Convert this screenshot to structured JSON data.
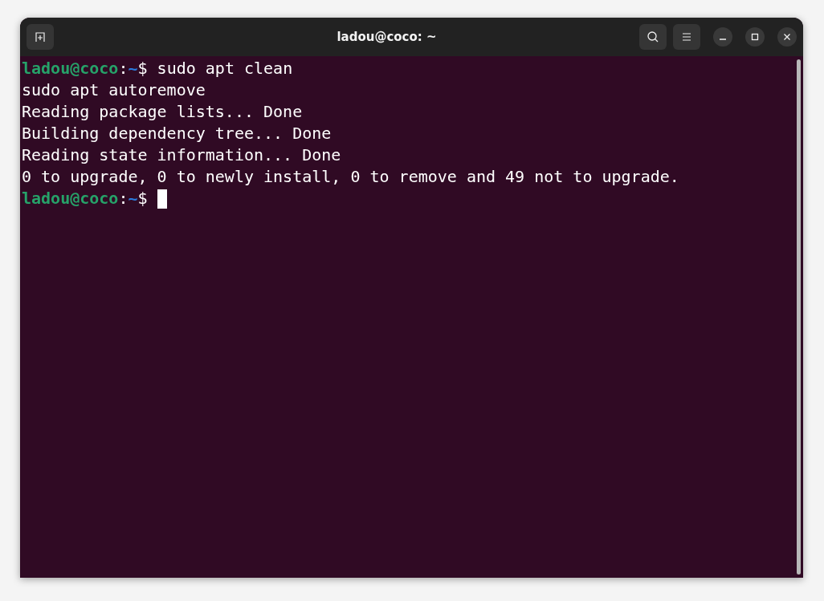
{
  "window": {
    "title": "ladou@coco: ~"
  },
  "terminal": {
    "lines": [
      {
        "kind": "prompt",
        "user_host": "ladou@coco",
        "separator": ":",
        "path": "~",
        "symbol": "$",
        "command": "sudo apt clean",
        "cursor": false
      },
      {
        "kind": "output",
        "text": "sudo apt autoremove"
      },
      {
        "kind": "output",
        "text": "Reading package lists... Done"
      },
      {
        "kind": "output",
        "text": "Building dependency tree... Done"
      },
      {
        "kind": "output",
        "text": "Reading state information... Done"
      },
      {
        "kind": "output",
        "text": "0 to upgrade, 0 to newly install, 0 to remove and 49 not to upgrade."
      },
      {
        "kind": "prompt",
        "user_host": "ladou@coco",
        "separator": ":",
        "path": "~",
        "symbol": "$",
        "cursor": true
      }
    ]
  }
}
